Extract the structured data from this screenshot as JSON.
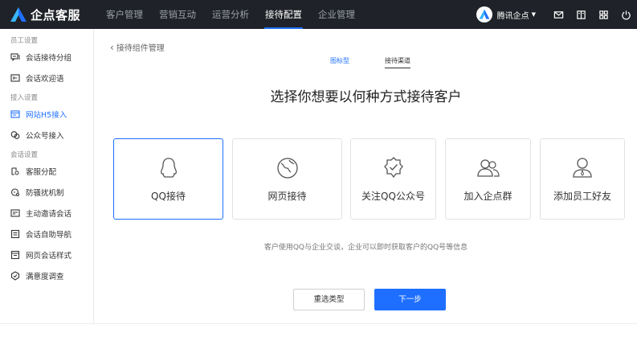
{
  "brand": {
    "name": "企点客服",
    "accent": "#1e6fff"
  },
  "nav": {
    "items": [
      {
        "label": "客户管理",
        "active": false
      },
      {
        "label": "营销互动",
        "active": false
      },
      {
        "label": "运营分析",
        "active": false
      },
      {
        "label": "接待配置",
        "active": true
      },
      {
        "label": "企业管理",
        "active": false
      }
    ]
  },
  "account": {
    "name": "腾讯企点"
  },
  "top_icons": [
    "mail-icon",
    "book-icon",
    "apps-icon",
    "power-icon"
  ],
  "sidebar": {
    "groups": [
      {
        "title": "员工设置",
        "items": [
          {
            "label": "会话接待分组",
            "icon": "chat-group-icon"
          },
          {
            "label": "会话欢迎语",
            "icon": "welcome-icon"
          }
        ]
      },
      {
        "title": "接入设置",
        "items": [
          {
            "label": "网站H5接入",
            "icon": "web-icon",
            "active": true
          },
          {
            "label": "公众号接入",
            "icon": "wechat-icon"
          }
        ]
      },
      {
        "title": "会话设置",
        "items": [
          {
            "label": "客服分配",
            "icon": "assign-icon"
          },
          {
            "label": "防骚扰机制",
            "icon": "shield-icon"
          },
          {
            "label": "主动邀请会话",
            "icon": "invite-icon"
          },
          {
            "label": "会话自助导航",
            "icon": "nav-icon"
          },
          {
            "label": "网页会话样式",
            "icon": "style-icon"
          },
          {
            "label": "满意度调查",
            "icon": "survey-icon"
          }
        ]
      }
    ]
  },
  "main": {
    "back_label": "接待组件管理",
    "steps": [
      "图标型",
      "接待渠道"
    ],
    "heading": "选择你想要以何种方式接待客户",
    "cards": [
      {
        "label": "QQ接待",
        "icon": "qq-icon",
        "selected": true
      },
      {
        "label": "网页接待",
        "icon": "globe-icon",
        "selected": false
      },
      {
        "label": "关注QQ公众号",
        "icon": "verified-badge-icon",
        "selected": false
      },
      {
        "label": "加入企点群",
        "icon": "group-icon",
        "selected": false
      },
      {
        "label": "添加员工好友",
        "icon": "staff-icon",
        "selected": false
      }
    ],
    "hint": "客户使用QQ与企业交谈，企业可以即时获取客户的QQ号等信息",
    "buttons": {
      "reselect": "重选类型",
      "next": "下一步"
    }
  }
}
